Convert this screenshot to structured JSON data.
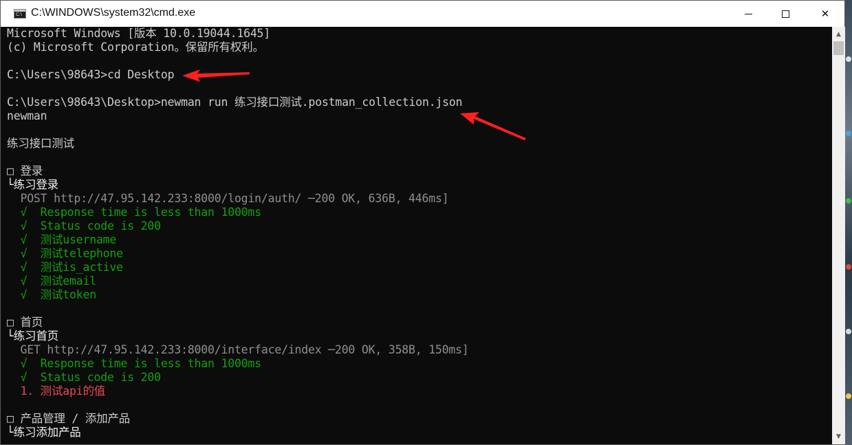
{
  "window": {
    "title": "C:\\WINDOWS\\system32\\cmd.exe",
    "icon_text": "C:\\",
    "minimize_icon": "minimize-icon",
    "maximize_icon": "maximize-icon",
    "close_symbol": "✕"
  },
  "colors": {
    "console_bg": "#0c0c0c",
    "default_text": "#cccccc",
    "dim_text": "#8f8f8f",
    "pass_green": "#13a10e",
    "fail_red": "#e74856",
    "annotation_arrow": "#ff1f1f"
  },
  "console": {
    "lines": [
      {
        "text": "Microsoft Windows [版本 10.0.19044.1645]",
        "style": "default"
      },
      {
        "text": "(c) Microsoft Corporation。保留所有权利。",
        "style": "default"
      },
      {
        "text": "",
        "style": "default"
      },
      {
        "text": "C:\\Users\\98643>cd Desktop",
        "style": "default"
      },
      {
        "text": "",
        "style": "default"
      },
      {
        "text": "C:\\Users\\98643\\Desktop>newman run 练习接口测试.postman_collection.json",
        "style": "default"
      },
      {
        "text": "newman",
        "style": "default"
      },
      {
        "text": "",
        "style": "default"
      },
      {
        "text": "练习接口测试",
        "style": "default"
      },
      {
        "text": "",
        "style": "default"
      },
      {
        "text": "□ 登录",
        "style": "default"
      },
      {
        "text": "└练习登录",
        "style": "white"
      },
      {
        "text": "  POST http://47.95.142.233:8000/login/auth/ ─200 OK, 636B, 446ms]",
        "style": "dim"
      },
      {
        "text": "  √  Response time is less than 1000ms",
        "style": "pass"
      },
      {
        "text": "  √  Status code is 200",
        "style": "pass"
      },
      {
        "text": "  √  测试username",
        "style": "pass"
      },
      {
        "text": "  √  测试telephone",
        "style": "pass"
      },
      {
        "text": "  √  测试is_active",
        "style": "pass"
      },
      {
        "text": "  √  测试email",
        "style": "pass"
      },
      {
        "text": "  √  测试token",
        "style": "pass"
      },
      {
        "text": "",
        "style": "default"
      },
      {
        "text": "□ 首页",
        "style": "default"
      },
      {
        "text": "└练习首页",
        "style": "white"
      },
      {
        "text": "  GET http://47.95.142.233:8000/interface/index ─200 OK, 358B, 150ms]",
        "style": "dim"
      },
      {
        "text": "  √  Response time is less than 1000ms",
        "style": "pass"
      },
      {
        "text": "  √  Status code is 200",
        "style": "pass"
      },
      {
        "text": "  1. 测试api的值",
        "style": "fail"
      },
      {
        "text": "",
        "style": "default"
      },
      {
        "text": "□ 产品管理 / 添加产品",
        "style": "default"
      },
      {
        "text": "└练习添加产品",
        "style": "white"
      }
    ]
  },
  "scrollbar": {
    "up_symbol": "▲",
    "down_symbol": "▼"
  }
}
